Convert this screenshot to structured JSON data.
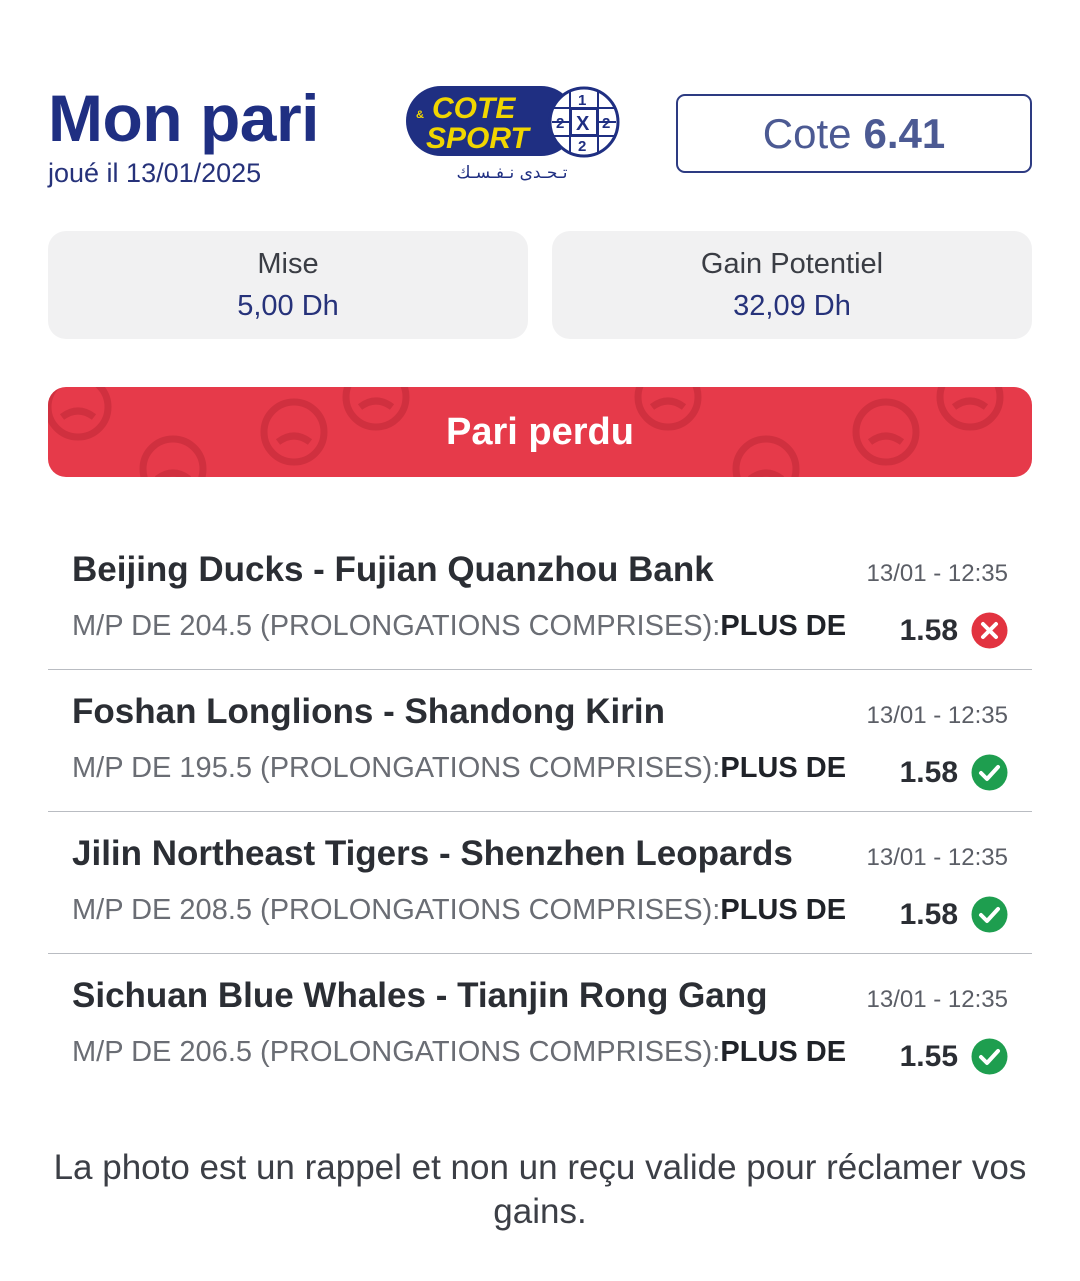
{
  "header": {
    "title": "Mon pari",
    "played_on": "joué il 13/01/2025",
    "cote_label": "Cote",
    "cote_value": "6.41"
  },
  "logo": {
    "line1": "COTE",
    "line2": "SPORT",
    "amp": "&",
    "tagline": "تـحـدى نـفـسـك",
    "badge_top": "1",
    "badge_left": "2",
    "badge_mid": "X",
    "badge_right": "2",
    "badge_bottom": "2"
  },
  "stats": {
    "stake_label": "Mise",
    "stake_value": "5,00 Dh",
    "gain_label": "Gain Potentiel",
    "gain_value": "32,09 Dh"
  },
  "result": {
    "label": "Pari perdu"
  },
  "events": [
    {
      "name": "Beijing Ducks - Fujian Quanzhou Bank",
      "time": "13/01 - 12:35",
      "market": "M/P DE 204.5 (PROLONGATIONS COMPRISES):",
      "selection": "PLUS DE",
      "odds": "1.58",
      "status": "lost"
    },
    {
      "name": "Foshan Longlions - Shandong Kirin",
      "time": "13/01 - 12:35",
      "market": "M/P DE 195.5 (PROLONGATIONS COMPRISES):",
      "selection": "PLUS DE",
      "odds": "1.58",
      "status": "won"
    },
    {
      "name": "Jilin Northeast Tigers - Shenzhen Leopards",
      "time": "13/01 - 12:35",
      "market": "M/P DE 208.5 (PROLONGATIONS COMPRISES):",
      "selection": "PLUS DE",
      "odds": "1.58",
      "status": "won"
    },
    {
      "name": "Sichuan Blue Whales - Tianjin Rong Gang",
      "time": "13/01 - 12:35",
      "market": "M/P DE 206.5 (PROLONGATIONS COMPRISES):",
      "selection": "PLUS DE",
      "odds": "1.55",
      "status": "won"
    }
  ],
  "footer": {
    "note": "La photo est un rappel et non un reçu valide pour réclamer vos gains."
  },
  "colors": {
    "brand_navy": "#1f2f82",
    "lost_red": "#e63a4a",
    "won_green": "#1e9e4f",
    "x_red": "#e23340"
  },
  "icons": {
    "lost": "x-circle-icon",
    "won": "check-circle-icon",
    "result_background": "sad-face-icon"
  }
}
